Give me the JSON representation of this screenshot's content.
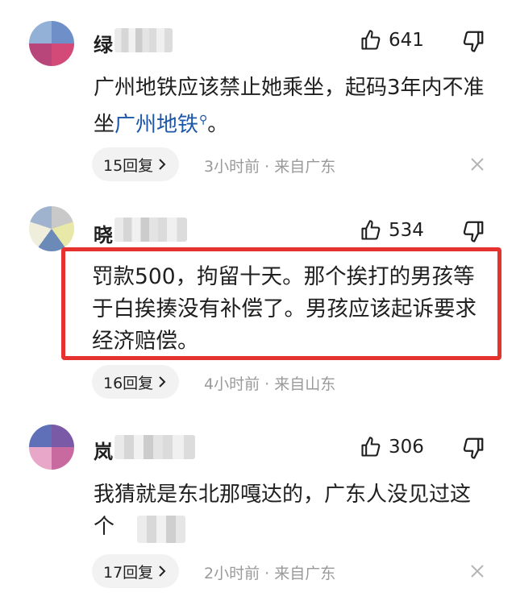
{
  "comments": [
    {
      "username": "绿",
      "likes": "641",
      "content_before": "广州地铁应该禁止她乘坐，起码3年内不准坐",
      "content_link": "广州地铁",
      "content_after": "。",
      "reply_label": "15回复",
      "meta": "3小时前 · 来自广东"
    },
    {
      "username": "晓",
      "likes": "534",
      "content": "罚款500，拘留十天。那个挨打的男孩等于白挨揍没有补偿了。男孩应该起诉要求经济赔偿。",
      "reply_label": "16回复",
      "meta": "4小时前 · 来自山东"
    },
    {
      "username": "岚",
      "likes": "306",
      "content_visible": "我猜就是东北那嘎达的，广东人没见过这个",
      "reply_label": "17回复",
      "meta": "2小时前 · 来自广东"
    }
  ],
  "icons": {
    "like": "thumbs-up-icon",
    "dislike": "thumbs-down-icon",
    "close": "close-icon",
    "chevron": "chevron-right-icon",
    "search": "search-icon"
  },
  "colors": {
    "highlight": "#e5322e",
    "link": "#1c57a8",
    "meta": "#9a9a9a",
    "pill": "#f2f2f2"
  }
}
